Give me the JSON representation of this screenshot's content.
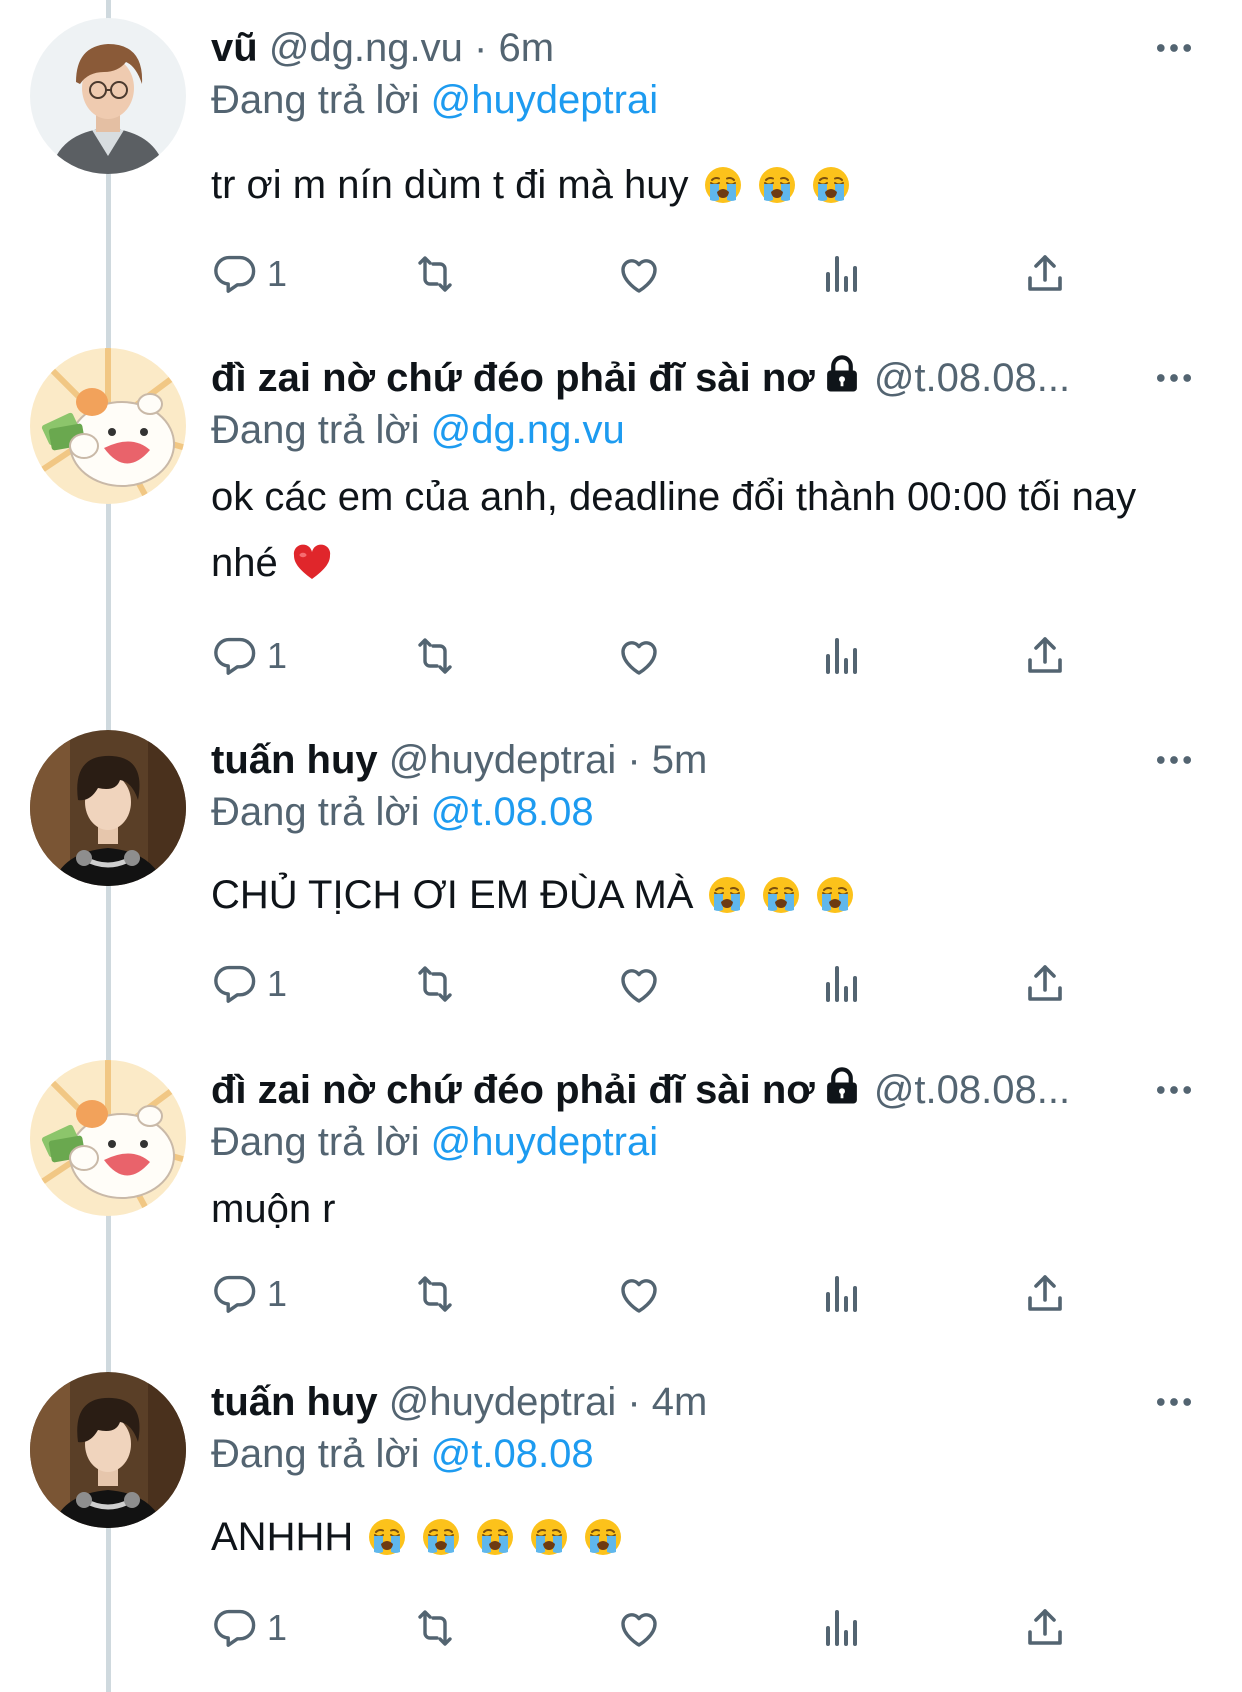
{
  "tweets": [
    {
      "name": "vũ",
      "handle": "@dg.ng.vu",
      "dot": "·",
      "time": "6m",
      "replying_label": "Đang trả lời",
      "replying_to": "@huydeptrai",
      "text": "tr ơi m nín dùm t đi mà huy",
      "emoji": [
        "crying-face",
        "crying-face",
        "crying-face"
      ],
      "reply_count": "1",
      "avatar": "man-with-glasses-avatar"
    },
    {
      "name": "đì zai nờ chứ đéo phải đĩ sài nơ",
      "locked": true,
      "handle": "@t.08.08...",
      "replying_label": "Đang trả lời",
      "replying_to": "@dg.ng.vu",
      "text": "ok các em của anh, deadline đổi thành 00:00 tối nay nhé",
      "emoji": [
        "red-heart"
      ],
      "reply_count": "1",
      "avatar": "cartoon-bear-money-avatar"
    },
    {
      "name": "tuấn huy",
      "handle": "@huydeptrai",
      "dot": "·",
      "time": "5m",
      "replying_label": "Đang trả lời",
      "replying_to": "@t.08.08",
      "text": "CHỦ TỊCH ƠI EM ĐÙA MÀ",
      "emoji": [
        "crying-face",
        "crying-face",
        "crying-face"
      ],
      "reply_count": "1",
      "avatar": "young-man-headphones-avatar"
    },
    {
      "name": "đì zai nờ chứ đéo phải đĩ sài nơ",
      "locked": true,
      "handle": "@t.08.08...",
      "replying_label": "Đang trả lời",
      "replying_to": "@huydeptrai",
      "text": "muộn r",
      "emoji": [],
      "reply_count": "1",
      "avatar": "cartoon-bear-money-avatar"
    },
    {
      "name": "tuấn huy",
      "handle": "@huydeptrai",
      "dot": "·",
      "time": "4m",
      "replying_label": "Đang trả lời",
      "replying_to": "@t.08.08",
      "text": "ANHHH",
      "emoji": [
        "crying-face",
        "crying-face",
        "crying-face",
        "crying-face",
        "crying-face"
      ],
      "reply_count": "1",
      "avatar": "young-man-headphones-avatar"
    }
  ],
  "colors": {
    "text": "#0f1419",
    "secondary": "#536471",
    "link": "#1d9bf0",
    "thread_line": "#cfd9de",
    "icon": "#536471"
  }
}
